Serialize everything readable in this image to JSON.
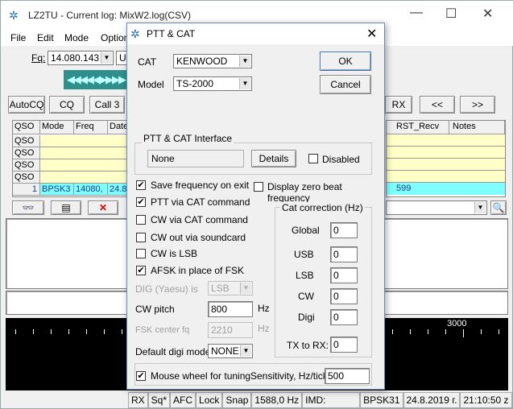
{
  "app": {
    "title": "LZ2TU - Current log: MixW2.log(CSV)",
    "icon": "butterfly-icon"
  },
  "menu": [
    "File",
    "Edit",
    "Mode",
    "Options"
  ],
  "freq": {
    "label": "Fq:",
    "value": "14.080.143",
    "mode_value": "US"
  },
  "macros": [
    "AutoCQ",
    "CQ",
    "Call 3"
  ],
  "right_macros": [
    "RX",
    "<<",
    ">>"
  ],
  "log": {
    "columns": [
      "QSO",
      "Mode",
      "Freq",
      "Date"
    ],
    "right_columns": [
      "RST_Recv",
      "Notes"
    ],
    "rows": [
      [
        "QSO",
        "",
        "",
        ""
      ],
      [
        "QSO",
        "",
        "",
        ""
      ],
      [
        "QSO",
        "",
        "",
        ""
      ],
      [
        "QSO",
        "",
        "",
        ""
      ]
    ],
    "current": [
      "1",
      "BPSK3",
      "14080,",
      "24.8"
    ],
    "current_rst": "599"
  },
  "waterfall": {
    "scale_label": "3000"
  },
  "status": [
    "RX",
    "Sq*",
    "AFC",
    "Lock",
    "Snap",
    "1588,0 Hz",
    "IMD:",
    "BPSK31",
    "24.8.2019 г.",
    "21:10:50 z"
  ],
  "dialog": {
    "title": "PTT & CAT",
    "cat_label": "CAT",
    "cat_value": "KENWOOD",
    "model_label": "Model",
    "model_value": "TS-2000",
    "ok": "OK",
    "cancel": "Cancel",
    "interface_group": "PTT & CAT Interface",
    "interface_value": "None",
    "details": "Details",
    "disabled": "Disabled",
    "options": [
      {
        "label": "Save frequency on exit",
        "checked": true
      },
      {
        "label": "PTT via CAT command",
        "checked": true
      },
      {
        "label": "CW via CAT command",
        "checked": false
      },
      {
        "label": "CW out via soundcard",
        "checked": false
      },
      {
        "label": "CW is LSB",
        "checked": false
      },
      {
        "label": "AFSK in place of FSK",
        "checked": true
      }
    ],
    "zero_beat": "Display zero beat frequency",
    "dig_label": "DIG (Yaesu) is",
    "dig_value": "LSB",
    "cw_pitch_label": "CW pitch",
    "cw_pitch_value": "800",
    "hz1": "Hz",
    "fsk_label": "FSK center fq",
    "fsk_value": "2210",
    "hz2": "Hz",
    "digi_mode_label": "Default digi mode",
    "digi_mode_value": "NONE",
    "correction_group": "Cat correction (Hz)",
    "corrections": [
      {
        "label": "Global",
        "value": "0"
      },
      {
        "label": "USB",
        "value": "0"
      },
      {
        "label": "LSB",
        "value": "0"
      },
      {
        "label": "CW",
        "value": "0"
      },
      {
        "label": "Digi",
        "value": "0"
      }
    ],
    "txrx_label": "TX to RX:",
    "txrx_value": "0",
    "wheel_label": "Mouse wheel for tuning",
    "sens_label": "Sensitivity, Hz/tick",
    "sens_value": "500"
  }
}
